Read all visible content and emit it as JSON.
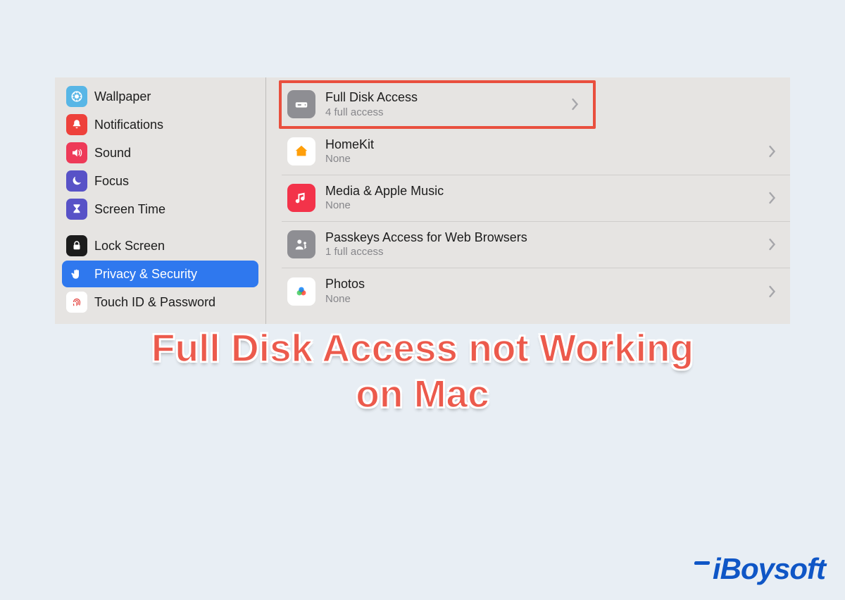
{
  "sidebar": {
    "items": [
      {
        "label": "Wallpaper",
        "icon": "wallpaper-icon",
        "selected": false
      },
      {
        "label": "Notifications",
        "icon": "bell-icon",
        "selected": false
      },
      {
        "label": "Sound",
        "icon": "speaker-icon",
        "selected": false
      },
      {
        "label": "Focus",
        "icon": "moon-icon",
        "selected": false
      },
      {
        "label": "Screen Time",
        "icon": "hourglass-icon",
        "selected": false
      },
      {
        "label": "Lock Screen",
        "icon": "lock-icon",
        "selected": false
      },
      {
        "label": "Privacy & Security",
        "icon": "hand-icon",
        "selected": true
      },
      {
        "label": "Touch ID & Password",
        "icon": "fingerprint-icon",
        "selected": false
      }
    ]
  },
  "main": {
    "rows": [
      {
        "title": "Full Disk Access",
        "subtitle": "4 full access",
        "icon": "disk-icon",
        "highlighted": true
      },
      {
        "title": "HomeKit",
        "subtitle": "None",
        "icon": "home-icon",
        "highlighted": false
      },
      {
        "title": "Media & Apple Music",
        "subtitle": "None",
        "icon": "music-icon",
        "highlighted": false
      },
      {
        "title": "Passkeys Access for Web Browsers",
        "subtitle": "1 full access",
        "icon": "passkey-icon",
        "highlighted": false
      },
      {
        "title": "Photos",
        "subtitle": "None",
        "icon": "photos-icon",
        "highlighted": false
      }
    ]
  },
  "caption": {
    "line1": "Full Disk Access not Working",
    "line2": "on Mac"
  },
  "brand": {
    "name": "iBoysoft"
  },
  "colors": {
    "accent": "#2f78ee",
    "highlight_border": "#e94f3e",
    "caption_text": "#ec5a4c",
    "brand_blue": "#0f56c6"
  }
}
